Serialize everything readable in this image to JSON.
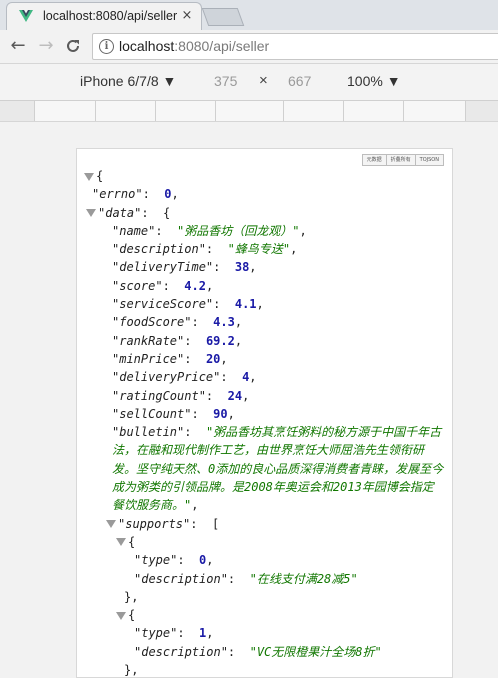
{
  "browser": {
    "tab_title": "localhost:8080/api/seller",
    "tab_close": "×",
    "url_host": "localhost",
    "url_rest": ":8080/api/seller",
    "back": "←",
    "forward": "→",
    "reload": "C"
  },
  "device_toolbar": {
    "device": "iPhone 6/7/8 ▼",
    "width": "375",
    "times": "×",
    "height": "667",
    "zoom": "100% ▼"
  },
  "json_viewer": {
    "buttons": [
      "元数据",
      "折叠所有",
      "TOJSON"
    ],
    "open_brace": "{",
    "close_obj": "},",
    "lines": {
      "errno_key": "\"errno\"",
      "errno_val": "0",
      "data_key": "\"data\"",
      "name_key": "\"name\"",
      "name_val": "\"粥品香坊（回龙观）\"",
      "description_key": "\"description\"",
      "description_val": "\"蜂鸟专送\"",
      "deliveryTime_key": "\"deliveryTime\"",
      "deliveryTime_val": "38",
      "score_key": "\"score\"",
      "score_val": "4.2",
      "serviceScore_key": "\"serviceScore\"",
      "serviceScore_val": "4.1",
      "foodScore_key": "\"foodScore\"",
      "foodScore_val": "4.3",
      "rankRate_key": "\"rankRate\"",
      "rankRate_val": "69.2",
      "minPrice_key": "\"minPrice\"",
      "minPrice_val": "20",
      "deliveryPrice_key": "\"deliveryPrice\"",
      "deliveryPrice_val": "4",
      "ratingCount_key": "\"ratingCount\"",
      "ratingCount_val": "24",
      "sellCount_key": "\"sellCount\"",
      "sellCount_val": "90",
      "bulletin_key": "\"bulletin\"",
      "bulletin_val": "\"粥品香坊其烹饪粥料的秘方源于中国千年古法，在融和现代制作工艺，由世界烹饪大师屈浩先生领衔研发。坚守纯天然、0添加的良心品质深得消费者青睐，发展至今成为粥类的引领品牌。是2008年奥运会和2013年园博会指定餐饮服务商。\"",
      "supports_key": "\"supports\"",
      "supports_open": "[",
      "s1_type_key": "\"type\"",
      "s1_type_val": "0",
      "s1_desc_key": "\"description\"",
      "s1_desc_val": "\"在线支付满28减5\"",
      "s2_type_key": "\"type\"",
      "s2_type_val": "1",
      "s2_desc_key": "\"description\"",
      "s2_desc_val": "\"VC无限橙果汁全场8折\""
    }
  }
}
